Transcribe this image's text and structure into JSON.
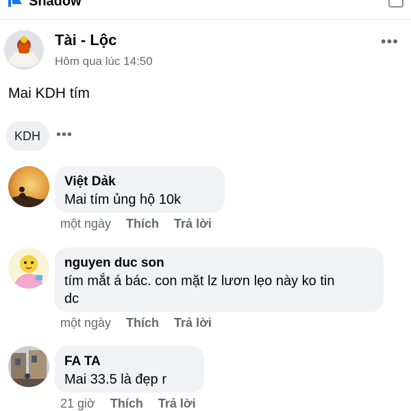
{
  "group": {
    "name": "Shadow",
    "icon": "flag-icon"
  },
  "post": {
    "author": "Tài - Lộc",
    "time": "Hôm qua lúc 14:50",
    "text": "Mai KDH tím",
    "tag": "KDH"
  },
  "comments": [
    {
      "name": "Việt Dảk",
      "lines": [
        "Mai tím ủng hộ 10k"
      ],
      "time": "một ngày",
      "like": "Thích",
      "reply": "Trả lời"
    },
    {
      "name": "nguyen duc son",
      "lines": [
        "tím mắt á bác. con mặt lz lươn lẹo này ko tin",
        "dc"
      ],
      "time": "một ngày",
      "like": "Thích",
      "reply": "Trả lời"
    },
    {
      "name": "FA TA",
      "lines": [
        "Mai 33.5 là đẹp r"
      ],
      "time": "21 giờ",
      "like": "Thích",
      "reply": "Trả lời"
    }
  ]
}
